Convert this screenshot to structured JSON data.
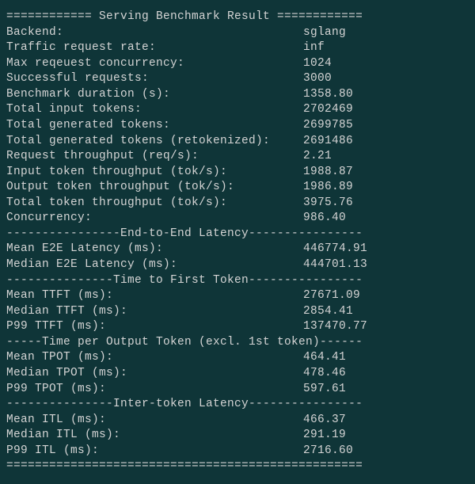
{
  "header": "============ Serving Benchmark Result ============",
  "rows_main": [
    {
      "label": "Backend:",
      "value": "sglang"
    },
    {
      "label": "Traffic request rate:",
      "value": "inf"
    },
    {
      "label": "Max reqeuest concurrency:",
      "value": "1024"
    },
    {
      "label": "Successful requests:",
      "value": "3000"
    },
    {
      "label": "Benchmark duration (s):",
      "value": "1358.80"
    },
    {
      "label": "Total input tokens:",
      "value": "2702469"
    },
    {
      "label": "Total generated tokens:",
      "value": "2699785"
    },
    {
      "label": "Total generated tokens (retokenized):",
      "value": "2691486"
    },
    {
      "label": "Request throughput (req/s):",
      "value": "2.21"
    },
    {
      "label": "Input token throughput (tok/s):",
      "value": "1988.87"
    },
    {
      "label": "Output token throughput (tok/s):",
      "value": "1986.89"
    },
    {
      "label": "Total token throughput (tok/s):",
      "value": "3975.76"
    },
    {
      "label": "Concurrency:",
      "value": "986.40"
    }
  ],
  "section_e2e": "----------------End-to-End Latency----------------",
  "rows_e2e": [
    {
      "label": "Mean E2E Latency (ms):",
      "value": "446774.91"
    },
    {
      "label": "Median E2E Latency (ms):",
      "value": "444701.13"
    }
  ],
  "section_ttft": "---------------Time to First Token----------------",
  "rows_ttft": [
    {
      "label": "Mean TTFT (ms):",
      "value": "27671.09"
    },
    {
      "label": "Median TTFT (ms):",
      "value": "2854.41"
    },
    {
      "label": "P99 TTFT (ms):",
      "value": "137470.77"
    }
  ],
  "section_tpot": "-----Time per Output Token (excl. 1st token)------",
  "rows_tpot": [
    {
      "label": "Mean TPOT (ms):",
      "value": "464.41"
    },
    {
      "label": "Median TPOT (ms):",
      "value": "478.46"
    },
    {
      "label": "P99 TPOT (ms):",
      "value": "597.61"
    }
  ],
  "section_itl": "---------------Inter-token Latency----------------",
  "rows_itl": [
    {
      "label": "Mean ITL (ms):",
      "value": "466.37"
    },
    {
      "label": "Median ITL (ms):",
      "value": "291.19"
    },
    {
      "label": "P99 ITL (ms):",
      "value": "2716.60"
    }
  ],
  "footer": "=================================================="
}
